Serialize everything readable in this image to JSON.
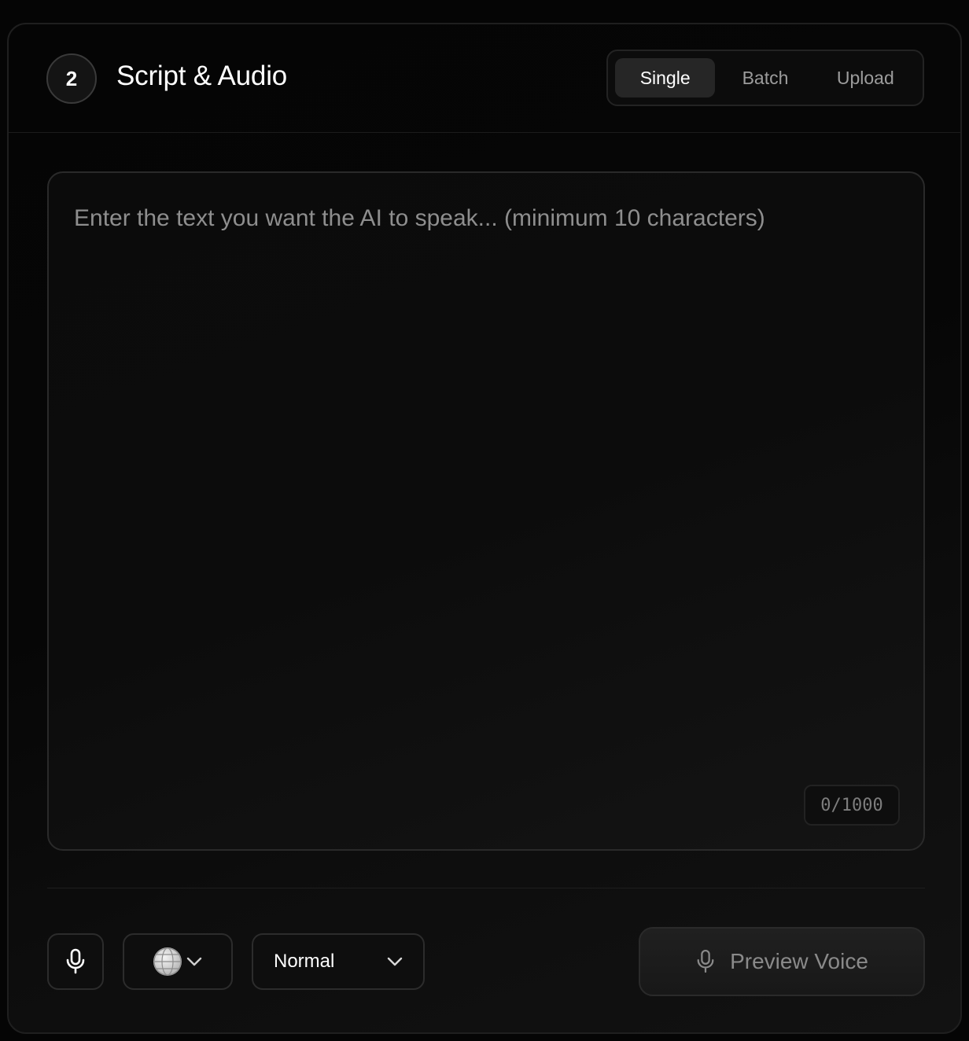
{
  "step": {
    "number": "2",
    "title": "Script & Audio"
  },
  "mode_tabs": {
    "selected": "Single",
    "items": [
      {
        "label": "Single"
      },
      {
        "label": "Batch"
      },
      {
        "label": "Upload"
      }
    ]
  },
  "script": {
    "placeholder": "Enter the text you want the AI to speak... (minimum 10 characters)",
    "value": "",
    "char_count": "0/1000"
  },
  "controls": {
    "mic_icon": "microphone-icon",
    "language_icon": "globe-icon",
    "speed_value": "Normal",
    "preview_label": "Preview Voice"
  },
  "colors": {
    "background": "#050505",
    "card_border": "#1f1f1f",
    "active_tab": "#262626",
    "placeholder_text": "#8e8e8e"
  }
}
